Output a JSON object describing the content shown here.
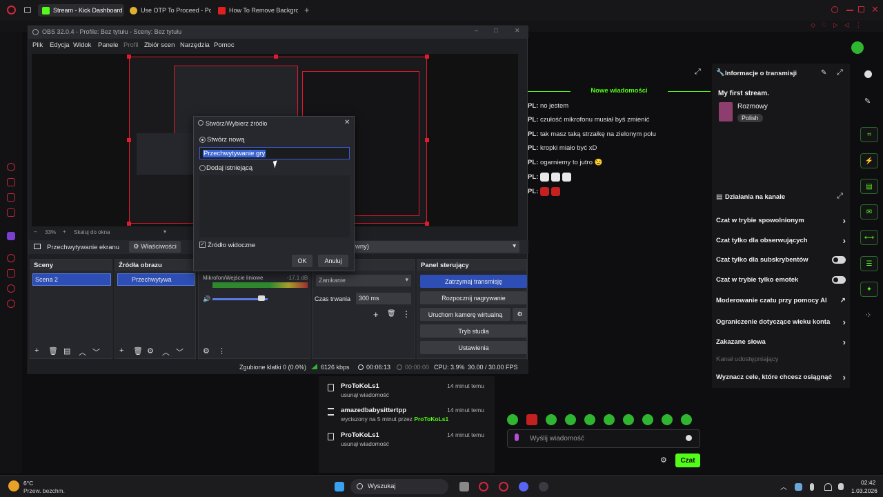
{
  "browser": {
    "tabs": [
      {
        "label": "Stream - Kick Dashboard"
      },
      {
        "label": "Use OTP To Proceed - Po"
      },
      {
        "label": "How To Remove Backgrou"
      }
    ]
  },
  "kick": {
    "chat": {
      "banner": "Nowe wiadomości",
      "messages": [
        {
          "user": "PL:",
          "text": "no jestem"
        },
        {
          "user": "PL:",
          "text": "czułość mikrofonu musiał byś zmienić"
        },
        {
          "user": "PL:",
          "text": "tak masz taką strzałkę na zielonym polu"
        },
        {
          "user": "PL:",
          "text": "kropki miało być xD"
        },
        {
          "user": "PL:",
          "text": "ogarniemy to jutro 😉"
        },
        {
          "user": "PL:",
          "text": ""
        },
        {
          "user": "PL:",
          "text": ""
        }
      ],
      "input_placeholder": "Wyślij wiadomość",
      "send_label": "Czat"
    },
    "info": {
      "title": "Informacje o transmisji",
      "stream_title": "My first stream.",
      "category": "Rozmowy",
      "language": "Polish"
    },
    "actions": {
      "title": "Działania na kanale",
      "items": [
        {
          "label": "Czat w trybie spowolnionym",
          "control": "chevron"
        },
        {
          "label": "Czat tylko dla obserwujących",
          "control": "chevron"
        },
        {
          "label": "Czat tylko dla subskrybentów",
          "control": "toggle"
        },
        {
          "label": "Czat w trybie tylko emotek",
          "control": "toggle"
        },
        {
          "label": "Moderowanie czatu przy pomocy AI",
          "control": "link"
        },
        {
          "label": "Ograniczenie dotyczące wieku konta",
          "control": "chevron"
        },
        {
          "label": "Zakazane słowa",
          "control": "chevron"
        },
        {
          "label": "Kanał udostępniający",
          "control": "none"
        },
        {
          "label": "Wyznacz cele, które chcesz osiągnąć",
          "control": "chevron"
        }
      ]
    },
    "modlog": [
      {
        "user": "ProToKoLs1",
        "detail": "usunął wiadomość",
        "time": "14 minut temu"
      },
      {
        "user": "amazedbabysittertpp",
        "detail_prefix": "wyciszony na 5 minut przez",
        "detail_by": "ProToKoLs1",
        "time": "14 minut temu"
      },
      {
        "user": "ProToKoLs1",
        "detail": "usunął wiadomość",
        "time": "14 minut temu"
      }
    ],
    "colors": {
      "accent": "#53fc18"
    }
  },
  "obs": {
    "title": "OBS 32.0.4 - Profile: Bez tytułu - Sceny: Bez tytułu",
    "menu": [
      "Plik",
      "Edycja",
      "Widok",
      "Panele",
      "Profil",
      "Zbiór scen",
      "Narzędzia",
      "Pomoc"
    ],
    "zoom": "33%",
    "zoom_mode": "Skaluj do okna",
    "source_bar": {
      "source": "Przechwytywanie ekranu",
      "properties": "Właściwości",
      "dropdown_tail": "wny)"
    },
    "docks": {
      "scenes": {
        "title": "Sceny",
        "items": [
          "Scena 2"
        ]
      },
      "sources": {
        "title": "Źródła obrazu",
        "items": [
          "Przechwytywa"
        ]
      },
      "mixer": {
        "track": "Mikrofon/Wejście liniowe",
        "level": "-17.1 dB"
      },
      "transitions": {
        "title_tail": "cja scen",
        "type": "Zanikanie",
        "duration_label": "Czas trwania",
        "duration": "300 ms"
      },
      "controls": {
        "title": "Panel sterujący",
        "buttons": [
          "Zatrzymaj transmisję",
          "Rozpocznij nagrywanie",
          "Uruchom kamerę wirtualną",
          "Tryb studia",
          "Ustawienia"
        ]
      }
    },
    "status": {
      "dropped": "Zgubione klatki 0 (0.0%)",
      "bitrate": "6126 kbps",
      "stream_time": "00:06:13",
      "rec_time": "00:00:00",
      "cpu": "CPU: 3.9%",
      "fps": "30.00 / 30.00 FPS"
    },
    "dialog": {
      "title": "Stwórz/Wybierz źródło",
      "create_new": "Stwórz nową",
      "name_value": "Przechwytywanie gry",
      "add_existing": "Dodaj istniejącą",
      "visible": "Źródło widoczne",
      "ok": "OK",
      "cancel": "Anuluj"
    }
  },
  "taskbar": {
    "weather_temp": "6°C",
    "weather_desc": "Przew. bezchm.",
    "search": "Wyszukaj",
    "time": "02:42",
    "date": "1.03.2026"
  }
}
